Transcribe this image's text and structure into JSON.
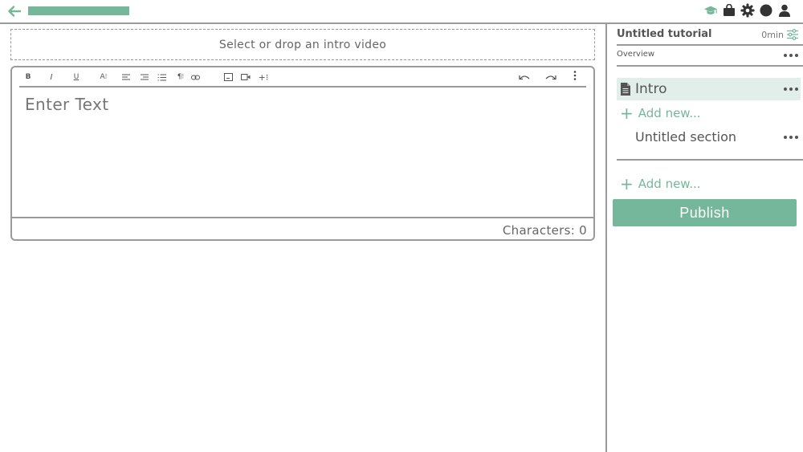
{
  "topbar": {
    "icons": [
      "back-arrow-icon",
      "graduation-cap-icon",
      "bag-icon",
      "gear-icon",
      "circle-icon",
      "user-icon"
    ],
    "accent_color": "#74b79a"
  },
  "main": {
    "video_drop_label": "Select or drop an intro video",
    "editor": {
      "toolbar": {
        "bold": "B",
        "italic": "I",
        "underline": "U",
        "font_size": "A⁝",
        "paragraph": "¶⁝",
        "insert": "+⁝"
      },
      "placeholder": "Enter Text",
      "character_count_label": "Characters: 0"
    }
  },
  "sidebar": {
    "title": "Untitled tutorial",
    "duration": "0min",
    "overview_label": "Overview",
    "items": [
      {
        "label": "Intro",
        "icon": "document-icon",
        "selected": true
      }
    ],
    "add_new_label": "Add new...",
    "sections": [
      {
        "label": "Untitled section"
      }
    ],
    "add_new_section_label": "Add new...",
    "publish_label": "Publish"
  }
}
